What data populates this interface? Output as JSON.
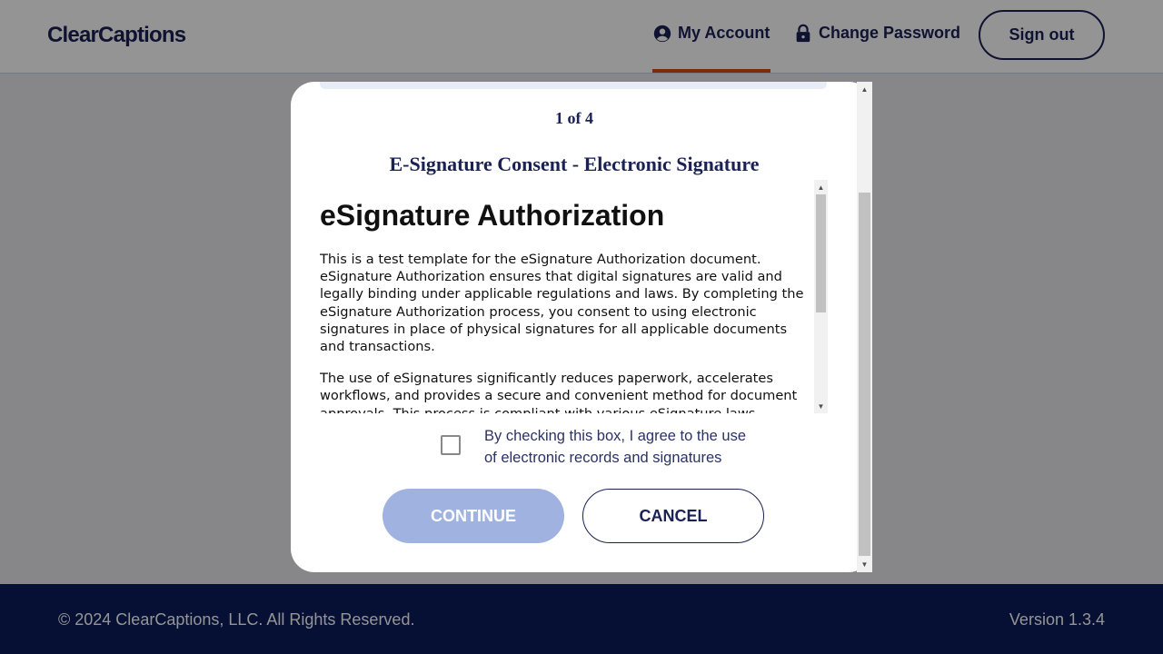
{
  "header": {
    "logo": "ClearCaptions",
    "nav": [
      {
        "label": "My Account",
        "icon": "account-circle-icon",
        "active": true
      },
      {
        "label": "Change Password",
        "icon": "lock-icon",
        "active": false
      }
    ],
    "signout_label": "Sign out"
  },
  "modal": {
    "page_count": "1 of 4",
    "doc_title": "E-Signature Consent - Electronic Signature",
    "document": {
      "heading": "eSignature Authorization",
      "paragraphs": [
        "This is a test template for the eSignature Authorization document. eSignature Authorization ensures that digital signatures are valid and legally binding under applicable regulations and laws. By completing the eSignature Authorization process, you consent to using electronic signatures in place of physical signatures for all applicable documents and transactions.",
        "The use of eSignatures significantly reduces paperwork, accelerates workflows, and provides a secure and convenient method for document approvals. This process is compliant with various eSignature laws"
      ]
    },
    "checkbox_label": "By checking this box, I agree to the use of electronic records and signatures",
    "checkbox_checked": false,
    "continue_label": "CONTINUE",
    "cancel_label": "CANCEL"
  },
  "footer": {
    "copyright": "© 2024 ClearCaptions, LLC. All Rights Reserved.",
    "version": "Version 1.3.4"
  },
  "colors": {
    "brand_navy": "#1a2155",
    "accent_orange": "#d64a1b",
    "footer_bg": "#0b1a5a",
    "continue_disabled": "#a0b3e0"
  }
}
